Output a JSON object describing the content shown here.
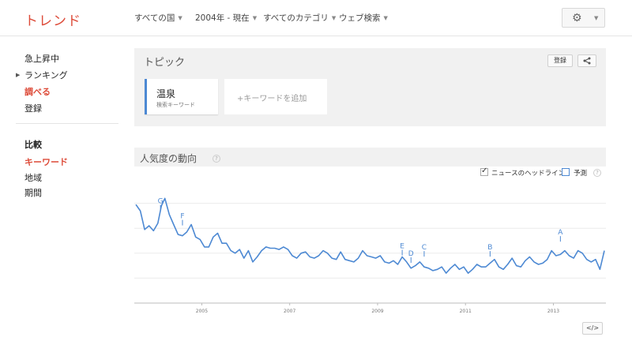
{
  "header": {
    "logo": "トレンド",
    "filters": [
      {
        "label": "すべての国"
      },
      {
        "label": "2004年 - 現在"
      },
      {
        "label": "すべてのカテゴリ"
      },
      {
        "label": "ウェブ検索"
      }
    ],
    "settings_icon": "gear-icon"
  },
  "sidebar": {
    "items": [
      {
        "label": "急上昇中"
      },
      {
        "label": "ランキング"
      },
      {
        "label": "調べる"
      },
      {
        "label": "登録"
      }
    ],
    "compare_heading": "比較",
    "compare_items": [
      {
        "label": "キーワード"
      },
      {
        "label": "地域"
      },
      {
        "label": "期間"
      }
    ]
  },
  "topic": {
    "title": "トピック",
    "subscribe_label": "登録",
    "share_icon": "share-icon",
    "term": {
      "name": "温泉",
      "type": "検索キーワード"
    },
    "add_placeholder": "+キーワードを追加"
  },
  "trend": {
    "title": "人気度の動向",
    "help": "?",
    "news_headlines_label": "ニュースのヘッドライン",
    "news_headlines_checked": true,
    "forecast_label": "予測",
    "forecast_checked": false,
    "embed_label": "</>"
  },
  "chart_data": {
    "type": "line",
    "series_color": "#4d89d3",
    "ylim": [
      0,
      100
    ],
    "grid": true,
    "y_labels_shown": false,
    "x_ticks": [
      "2005",
      "2007",
      "2009",
      "2011",
      "2013"
    ],
    "x_range": [
      2004.0,
      2014.66
    ],
    "series": [
      {
        "values": [
          [
            2004.0,
            79
          ],
          [
            2004.1,
            74
          ],
          [
            2004.2,
            59
          ],
          [
            2004.3,
            62
          ],
          [
            2004.4,
            58
          ],
          [
            2004.5,
            64
          ],
          [
            2004.58,
            78
          ],
          [
            2004.66,
            84
          ],
          [
            2004.76,
            71
          ],
          [
            2004.86,
            63
          ],
          [
            2004.96,
            55
          ],
          [
            2005.06,
            54
          ],
          [
            2005.16,
            57
          ],
          [
            2005.26,
            63
          ],
          [
            2005.36,
            53
          ],
          [
            2005.46,
            51
          ],
          [
            2005.56,
            45
          ],
          [
            2005.66,
            45
          ],
          [
            2005.76,
            53
          ],
          [
            2005.86,
            56
          ],
          [
            2005.96,
            48
          ],
          [
            2006.06,
            48
          ],
          [
            2006.16,
            42
          ],
          [
            2006.26,
            40
          ],
          [
            2006.36,
            43
          ],
          [
            2006.46,
            36
          ],
          [
            2006.56,
            42
          ],
          [
            2006.66,
            33
          ],
          [
            2006.76,
            37
          ],
          [
            2006.86,
            42
          ],
          [
            2006.96,
            45
          ],
          [
            2007.06,
            44
          ],
          [
            2007.16,
            44
          ],
          [
            2007.26,
            43
          ],
          [
            2007.36,
            45
          ],
          [
            2007.46,
            43
          ],
          [
            2007.56,
            38
          ],
          [
            2007.66,
            36
          ],
          [
            2007.76,
            40
          ],
          [
            2007.86,
            41
          ],
          [
            2007.96,
            37
          ],
          [
            2008.06,
            36
          ],
          [
            2008.16,
            38
          ],
          [
            2008.26,
            42
          ],
          [
            2008.36,
            40
          ],
          [
            2008.46,
            36
          ],
          [
            2008.56,
            35
          ],
          [
            2008.66,
            41
          ],
          [
            2008.76,
            35
          ],
          [
            2008.86,
            34
          ],
          [
            2008.96,
            33
          ],
          [
            2009.06,
            36
          ],
          [
            2009.16,
            42
          ],
          [
            2009.26,
            38
          ],
          [
            2009.36,
            37
          ],
          [
            2009.46,
            36
          ],
          [
            2009.56,
            38
          ],
          [
            2009.66,
            33
          ],
          [
            2009.76,
            32
          ],
          [
            2009.86,
            34
          ],
          [
            2009.96,
            31
          ],
          [
            2010.06,
            37
          ],
          [
            2010.16,
            33
          ],
          [
            2010.26,
            28
          ],
          [
            2010.36,
            30
          ],
          [
            2010.46,
            33
          ],
          [
            2010.56,
            29
          ],
          [
            2010.66,
            28
          ],
          [
            2010.76,
            26
          ],
          [
            2010.86,
            27
          ],
          [
            2010.96,
            29
          ],
          [
            2011.06,
            24
          ],
          [
            2011.16,
            28
          ],
          [
            2011.26,
            31
          ],
          [
            2011.36,
            27
          ],
          [
            2011.46,
            29
          ],
          [
            2011.56,
            24
          ],
          [
            2011.66,
            27
          ],
          [
            2011.76,
            31
          ],
          [
            2011.86,
            29
          ],
          [
            2011.96,
            29
          ],
          [
            2012.06,
            32
          ],
          [
            2012.16,
            35
          ],
          [
            2012.26,
            29
          ],
          [
            2012.36,
            27
          ],
          [
            2012.46,
            31
          ],
          [
            2012.56,
            36
          ],
          [
            2012.66,
            30
          ],
          [
            2012.76,
            29
          ],
          [
            2012.86,
            34
          ],
          [
            2012.96,
            37
          ],
          [
            2013.06,
            33
          ],
          [
            2013.16,
            31
          ],
          [
            2013.26,
            32
          ],
          [
            2013.36,
            35
          ],
          [
            2013.46,
            42
          ],
          [
            2013.56,
            38
          ],
          [
            2013.66,
            39
          ],
          [
            2013.76,
            42
          ],
          [
            2013.86,
            38
          ],
          [
            2013.96,
            36
          ],
          [
            2014.06,
            42
          ],
          [
            2014.16,
            40
          ],
          [
            2014.26,
            35
          ],
          [
            2014.36,
            33
          ],
          [
            2014.46,
            35
          ],
          [
            2014.56,
            27
          ],
          [
            2014.66,
            42
          ]
        ]
      }
    ],
    "annotations": [
      {
        "label": "G",
        "x": 2004.56,
        "y": 73
      },
      {
        "label": "F",
        "x": 2005.06,
        "y": 61
      },
      {
        "label": "E",
        "x": 2010.06,
        "y": 37
      },
      {
        "label": "D",
        "x": 2010.26,
        "y": 31
      },
      {
        "label": "C",
        "x": 2010.56,
        "y": 36
      },
      {
        "label": "B",
        "x": 2012.06,
        "y": 36
      },
      {
        "label": "A",
        "x": 2013.66,
        "y": 48
      }
    ]
  }
}
